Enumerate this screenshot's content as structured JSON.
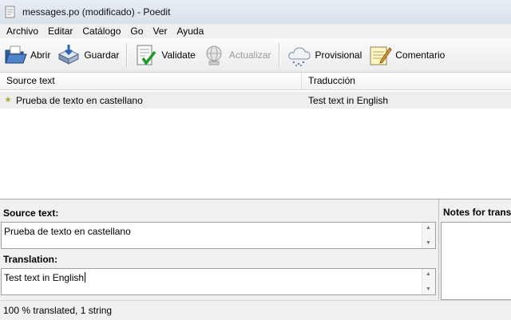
{
  "window": {
    "title": "messages.po (modificado) - Poedit"
  },
  "menu": [
    "Archivo",
    "Editar",
    "Catálogo",
    "Go",
    "Ver",
    "Ayuda"
  ],
  "toolbar": {
    "open": {
      "label": "Abrir",
      "icon": "folder-open-icon"
    },
    "save": {
      "label": "Guardar",
      "icon": "save-disk-icon"
    },
    "validate": {
      "label": "Validate",
      "icon": "validate-checkmark-icon"
    },
    "update": {
      "label": "Actualizar",
      "icon": "globe-update-icon",
      "disabled": true
    },
    "fuzzy": {
      "label": "Provisional",
      "icon": "cloud-icon"
    },
    "comment": {
      "label": "Comentario",
      "icon": "notepad-icon"
    }
  },
  "list": {
    "headers": {
      "source": "Source text",
      "translation": "Traducción"
    },
    "rows": [
      {
        "source": "Prueba de texto en castellano",
        "translation": "Test text in English"
      }
    ]
  },
  "editor": {
    "source_label": "Source text:",
    "source_value": "Prueba de texto en castellano",
    "translation_label": "Translation:",
    "translation_value": "Test text in English",
    "notes_label": "Notes for transl"
  },
  "status": "100 % translated, 1 string"
}
